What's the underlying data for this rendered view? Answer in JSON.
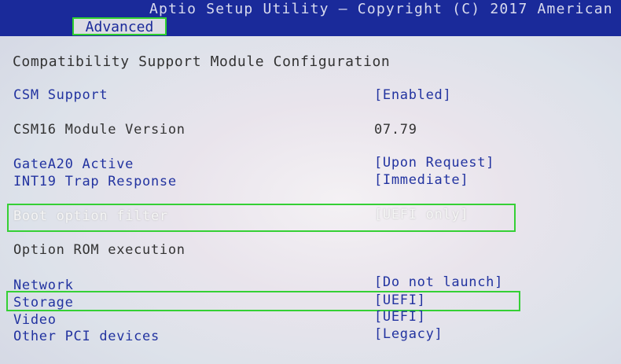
{
  "header": {
    "title": "Aptio Setup Utility – Copyright (C) 2017 American",
    "tab": "Advanced"
  },
  "page": {
    "heading": "Compatibility Support Module Configuration",
    "settings": [
      {
        "label": "CSM Support",
        "value": "[Enabled]"
      },
      {
        "label": "CSM16 Module Version",
        "value": "07.79"
      },
      {
        "label": "GateA20 Active",
        "value": "[Upon Request]"
      },
      {
        "label": "INT19 Trap Response",
        "value": "[Immediate]"
      },
      {
        "label": "Boot option filter",
        "value": "[UEFI only]"
      },
      {
        "label": "Option ROM execution"
      },
      {
        "label": "Network",
        "value": "[Do not launch]"
      },
      {
        "label": "Storage",
        "value": "[UEFI]"
      },
      {
        "label": "Video",
        "value": "[UEFI]"
      },
      {
        "label": "Other PCI devices",
        "value": "[Legacy]"
      }
    ]
  },
  "colors": {
    "header_bg": "#1a2a9a",
    "option_text": "#2233a0",
    "highlight_box": "#35d035"
  }
}
